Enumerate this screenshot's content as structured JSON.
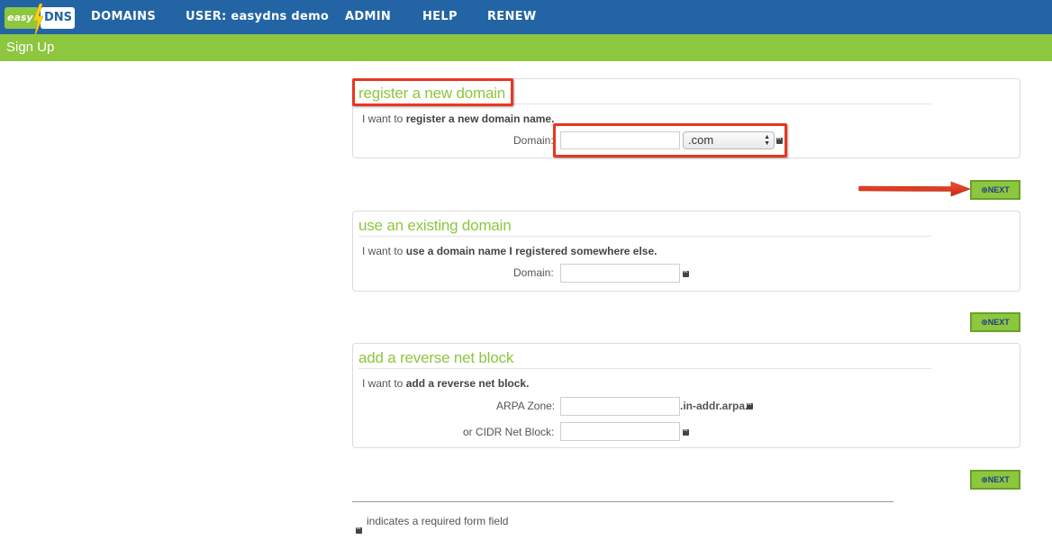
{
  "header": {
    "logo": {
      "part1": "easy",
      "part2": "DNS"
    },
    "nav": [
      "DOMAINS",
      "USER: easydns demo",
      "ADMIN",
      "HELP",
      "RENEW"
    ],
    "subtitle": "Sign Up"
  },
  "panels": {
    "register": {
      "title": "register a new domain",
      "intro_prefix": "I want to ",
      "intro_bold": "register a new domain name.",
      "domain_label": "Domain:",
      "domain_value": "",
      "tld_selected": ".com"
    },
    "existing": {
      "title": "use an existing domain",
      "intro_prefix": "I want to ",
      "intro_bold": "use a domain name I registered somewhere else.",
      "domain_label": "Domain:",
      "domain_value": ""
    },
    "reverse": {
      "title": "add a reverse net block",
      "intro_prefix": "I want to ",
      "intro_bold": "add a reverse net block.",
      "arpa_label": "ARPA Zone:",
      "arpa_suffix": ".in-addr.arpa.",
      "cidr_label": "or CIDR Net Block:"
    }
  },
  "buttons": {
    "next_label": "⊕NEXT"
  },
  "footer": {
    "note": "indicates a required form field"
  },
  "colors": {
    "nav_blue": "#2364a5",
    "brand_green": "#8dc63f",
    "highlight_red": "#e8371e"
  }
}
